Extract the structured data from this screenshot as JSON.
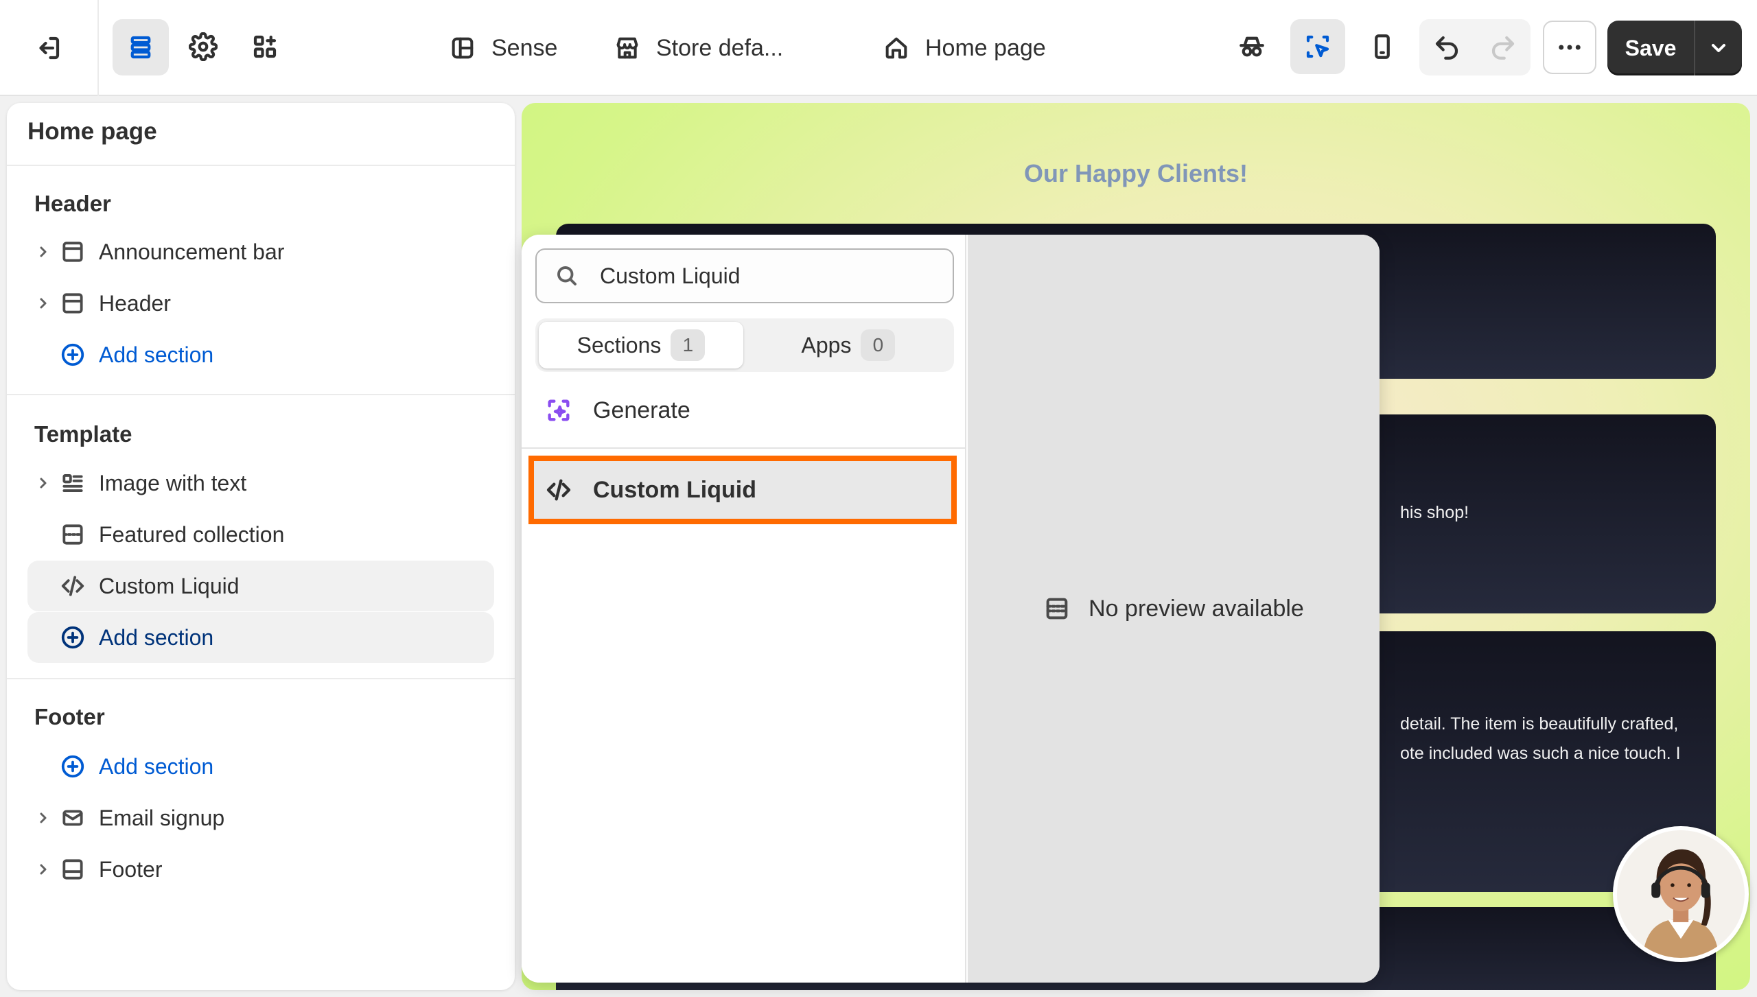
{
  "topbar": {
    "exit_icon": "exit-icon",
    "theme_name": "Sense",
    "store_context": "Store defa...",
    "page_selector": "Home page",
    "save_label": "Save"
  },
  "sidebar": {
    "title": "Home page",
    "groups": {
      "header": "Header",
      "template": "Template",
      "footer": "Footer"
    },
    "header_items": [
      "Announcement bar",
      "Header"
    ],
    "template_items": [
      "Image with text",
      "Featured collection",
      "Custom Liquid"
    ],
    "footer_items": [
      "Email signup",
      "Footer"
    ],
    "add_section": "Add section"
  },
  "preview": {
    "heading": "Our Happy Clients!",
    "card2_text": "his shop!",
    "card3_line1": "detail. The item is beautifully crafted,",
    "card3_line2": "ote included was such a nice touch. I"
  },
  "picker": {
    "search_value": "Custom Liquid",
    "tab_sections": "Sections",
    "tab_sections_count": "1",
    "tab_apps": "Apps",
    "tab_apps_count": "0",
    "generate_label": "Generate",
    "result_label": "Custom Liquid",
    "no_preview": "No preview available"
  },
  "colors": {
    "accent_link": "#005bd3",
    "highlight": "#ff6a00",
    "save_bg": "#303030",
    "generate_icon": "#8a4df0"
  }
}
